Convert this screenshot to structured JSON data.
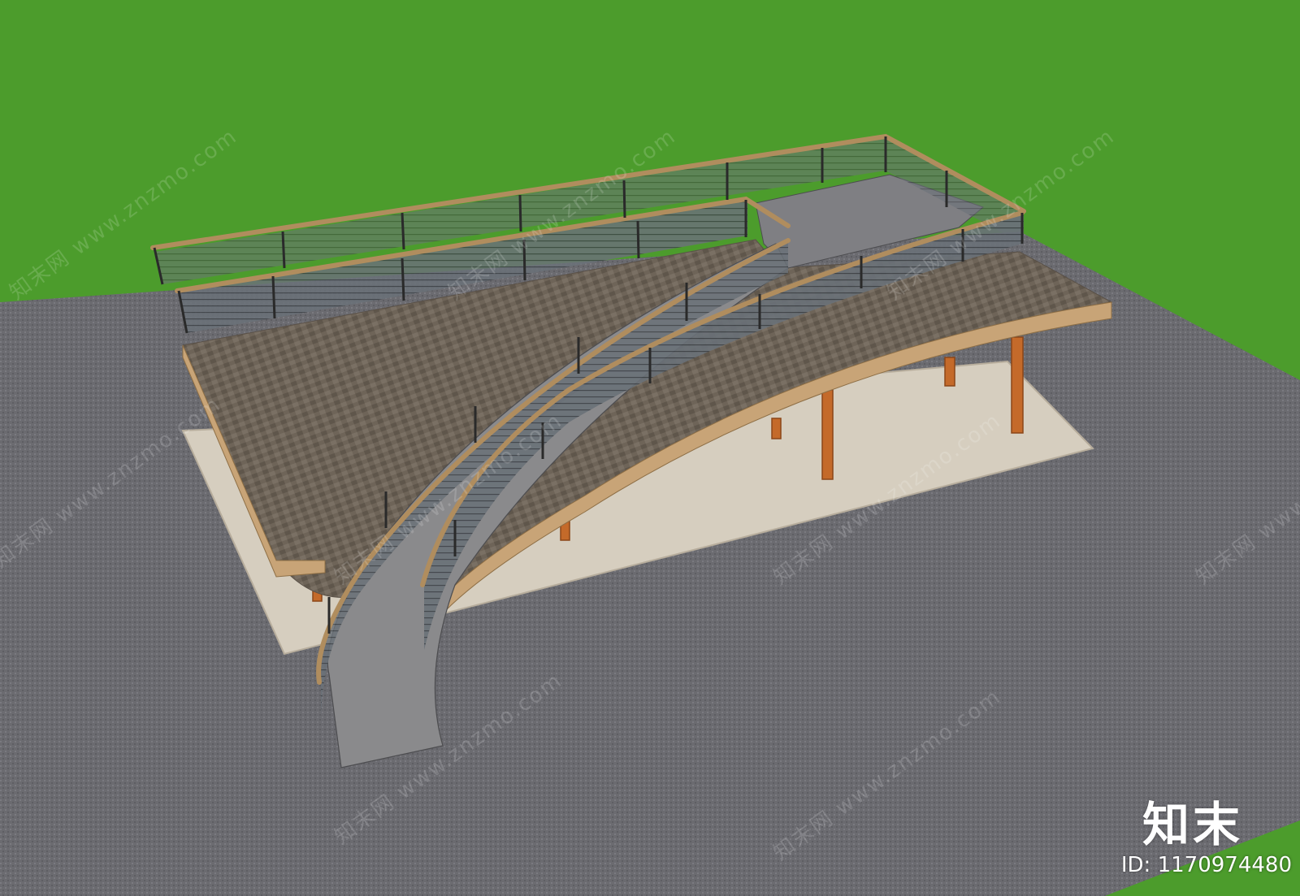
{
  "watermark": {
    "logo_text": "知末",
    "id_label": "ID: 1170974480",
    "pattern_text": "知末网 www.znzmo.com"
  },
  "colors": {
    "grass": "#4c9c2c",
    "ground": "#6b6b70",
    "slab": "#d6cebf",
    "deck_top": "#6e6458",
    "deck_fascia": "#c8a477",
    "post": "#c46a2a",
    "rail": "#b08d5e",
    "ramp": "#8a8a8c",
    "rail_panel": "#666d73"
  }
}
